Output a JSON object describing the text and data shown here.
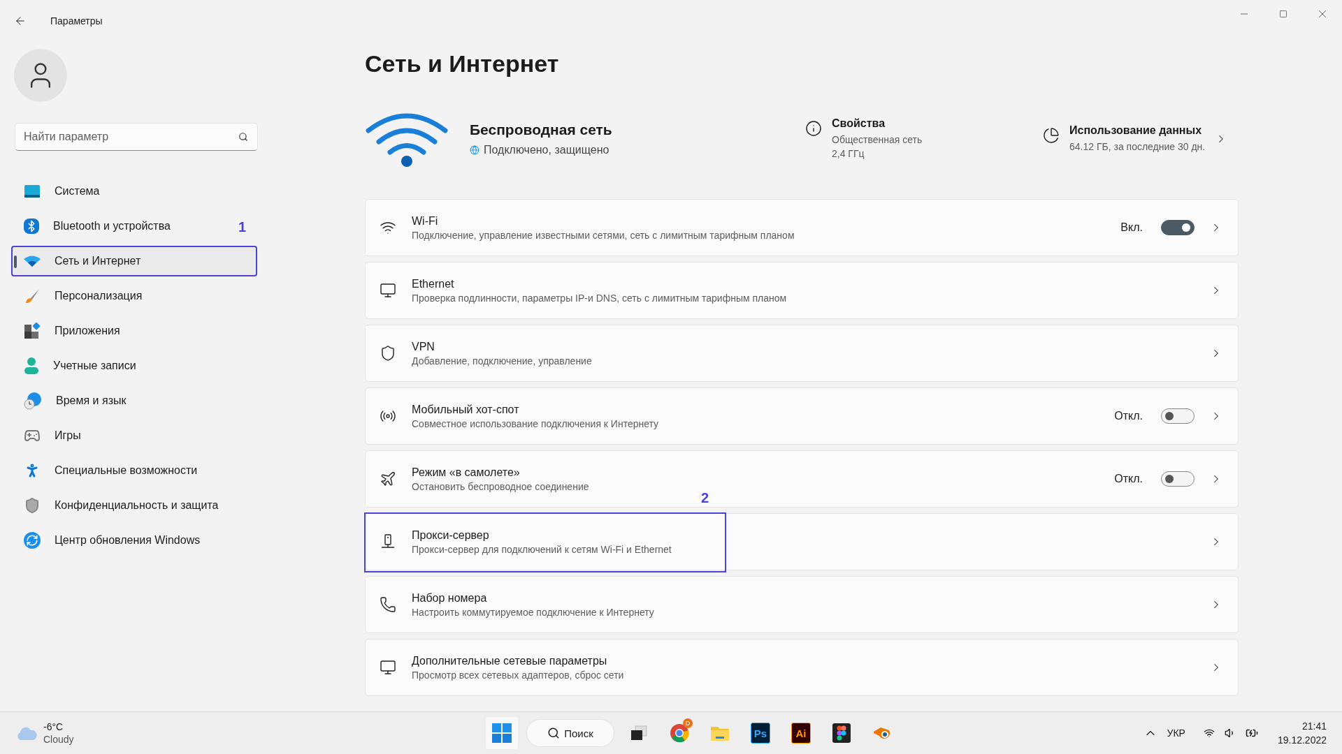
{
  "window": {
    "title": "Параметры"
  },
  "search": {
    "placeholder": "Найти параметр"
  },
  "sidebar": {
    "items": [
      {
        "kind": "system",
        "label": "Система",
        "selected": false,
        "highlighted": false
      },
      {
        "kind": "bluetooth",
        "label": "Bluetooth и устройства",
        "selected": false,
        "highlighted": false,
        "marker": "1"
      },
      {
        "kind": "network",
        "label": "Сеть и Интернет",
        "selected": true,
        "highlighted": true
      },
      {
        "kind": "personalize",
        "label": "Персонализация",
        "selected": false,
        "highlighted": false
      },
      {
        "kind": "apps",
        "label": "Приложения",
        "selected": false,
        "highlighted": false
      },
      {
        "kind": "accounts",
        "label": "Учетные записи",
        "selected": false,
        "highlighted": false
      },
      {
        "kind": "time",
        "label": "Время и язык",
        "selected": false,
        "highlighted": false
      },
      {
        "kind": "games",
        "label": "Игры",
        "selected": false,
        "highlighted": false
      },
      {
        "kind": "access",
        "label": "Специальные возможности",
        "selected": false,
        "highlighted": false
      },
      {
        "kind": "privacy",
        "label": "Конфиденциальность и защита",
        "selected": false,
        "highlighted": false
      },
      {
        "kind": "update",
        "label": "Центр обновления Windows",
        "selected": false,
        "highlighted": false
      }
    ]
  },
  "page": {
    "title": "Сеть и Интернет"
  },
  "hero": {
    "name": "Беспроводная сеть",
    "status": "Подключено, защищено",
    "properties": {
      "title": "Свойства",
      "lines": [
        "Общественная сеть",
        "2,4 ГГц"
      ]
    },
    "data_usage": {
      "title": "Использование данных",
      "subtitle": "64.12 ГБ, за последние 30 дн."
    }
  },
  "cards": [
    {
      "kind": "wifi",
      "title": "Wi-Fi",
      "subtitle": "Подключение, управление известными сетями, сеть с лимитным тарифным планом",
      "toggle": true,
      "on": true,
      "state_label": "Вкл.",
      "highlighted": false
    },
    {
      "kind": "ethernet",
      "title": "Ethernet",
      "subtitle": "Проверка подлинности, параметры IP-и DNS, сеть с лимитным тарифным планом",
      "toggle": false,
      "highlighted": false
    },
    {
      "kind": "vpn",
      "title": "VPN",
      "subtitle": "Добавление, подключение, управление",
      "toggle": false,
      "highlighted": false
    },
    {
      "kind": "hotspot",
      "title": "Мобильный хот-спот",
      "subtitle": "Совместное использование подключения к Интернету",
      "toggle": true,
      "on": false,
      "state_label": "Откл.",
      "highlighted": false
    },
    {
      "kind": "airplane",
      "title": "Режим «в самолете»",
      "subtitle": "Остановить беспроводное соединение",
      "toggle": true,
      "on": false,
      "state_label": "Откл.",
      "highlighted": false
    },
    {
      "kind": "proxy",
      "title": "Прокси-сервер",
      "subtitle": "Прокси-сервер для подключений к сетям Wi-Fi и Ethernet",
      "toggle": false,
      "highlighted": true,
      "marker": "2"
    },
    {
      "kind": "dialup",
      "title": "Набор номера",
      "subtitle": "Настроить коммутируемое подключение к Интернету",
      "toggle": false,
      "highlighted": false
    },
    {
      "kind": "advanced",
      "title": "Дополнительные сетевые параметры",
      "subtitle": "Просмотр всех сетевых адаптеров, сброс сети",
      "toggle": false,
      "highlighted": false
    }
  ],
  "taskbar": {
    "weather": {
      "temp": "-6°C",
      "condition": "Cloudy"
    },
    "search_label": "Поиск",
    "apps": [
      {
        "kind": "taskview"
      },
      {
        "kind": "chrome",
        "badge": "D"
      },
      {
        "kind": "folder"
      },
      {
        "kind": "ps",
        "label": "Ps"
      },
      {
        "kind": "ai",
        "label": "Ai"
      },
      {
        "kind": "figma"
      },
      {
        "kind": "blender"
      }
    ],
    "language": "УКР",
    "time": "21:41",
    "date": "19.12.2022"
  }
}
